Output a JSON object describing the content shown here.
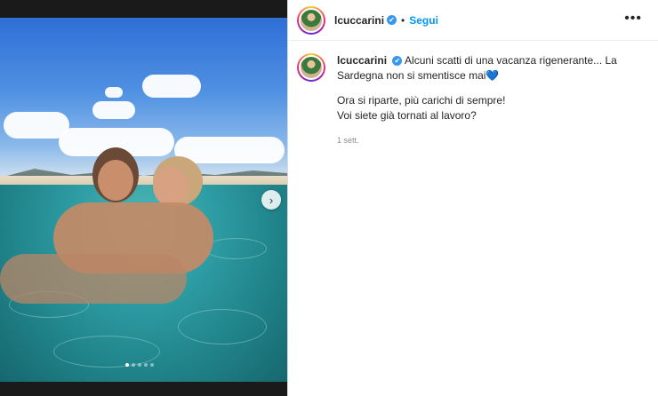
{
  "post": {
    "username": "lcuccarini",
    "verified_mark": "✔",
    "separator": "•",
    "follow_label": "Segui",
    "more_label": "•••",
    "caption_line1": "Alcuni scatti di una vacanza rigenerante... La Sardegna non si smentisce mai",
    "caption_heart": "💙",
    "caption_line2": "Ora si riparte, più carichi di sempre!",
    "caption_line3": "Voi siete già tornati al lavoro?",
    "timestamp": "1 sett.",
    "carousel": {
      "next_arrow": "›",
      "total_slides": 5,
      "current_slide": 1
    }
  },
  "icons": {
    "verified": "verified-badge-icon",
    "more": "more-options-icon",
    "next": "chevron-right-icon"
  },
  "colors": {
    "follow_blue": "#0095f6",
    "verified_blue": "#3897f0",
    "heart_blue": "#1b6fd6"
  }
}
